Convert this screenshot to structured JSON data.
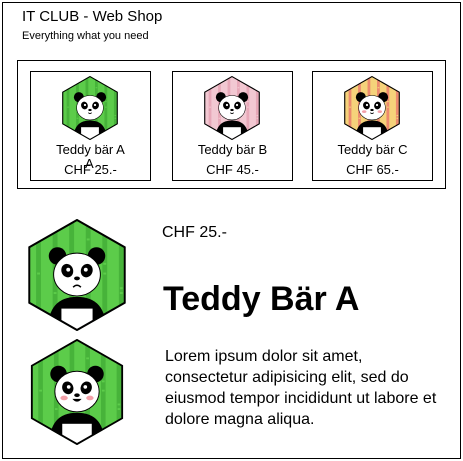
{
  "header": {
    "title": "IT CLUB - Web Shop",
    "subtitle": "Everything what you need"
  },
  "products": [
    {
      "name": "Teddy bär A",
      "price": "CHF 25.-",
      "bg_color": "#5ccc4a",
      "stripe_color": "#3ea833",
      "icon": "panda-icon"
    },
    {
      "name": "Teddy bär B",
      "price": "CHF 45.-",
      "bg_color": "#f2c8d2",
      "stripe_color": "#e39aad",
      "icon": "panda-icon"
    },
    {
      "name": "Teddy bär C",
      "price": "CHF 65.-",
      "bg_color": "#f5d27a",
      "stripe_color": "#e86a6a",
      "icon": "panda-icon"
    }
  ],
  "overlap_fragment": "A",
  "detail": {
    "price": "CHF 25.-",
    "title": "Teddy Bär A",
    "description": "Lorem ipsum dolor sit amet, consectetur adipisicing elit, sed do eiusmod tempor incididunt ut labore et dolore magna aliqua.",
    "images": [
      {
        "icon": "panda-sad-icon",
        "bg_color": "#5ccc4a"
      },
      {
        "icon": "panda-happy-icon",
        "bg_color": "#5ccc4a"
      }
    ]
  }
}
